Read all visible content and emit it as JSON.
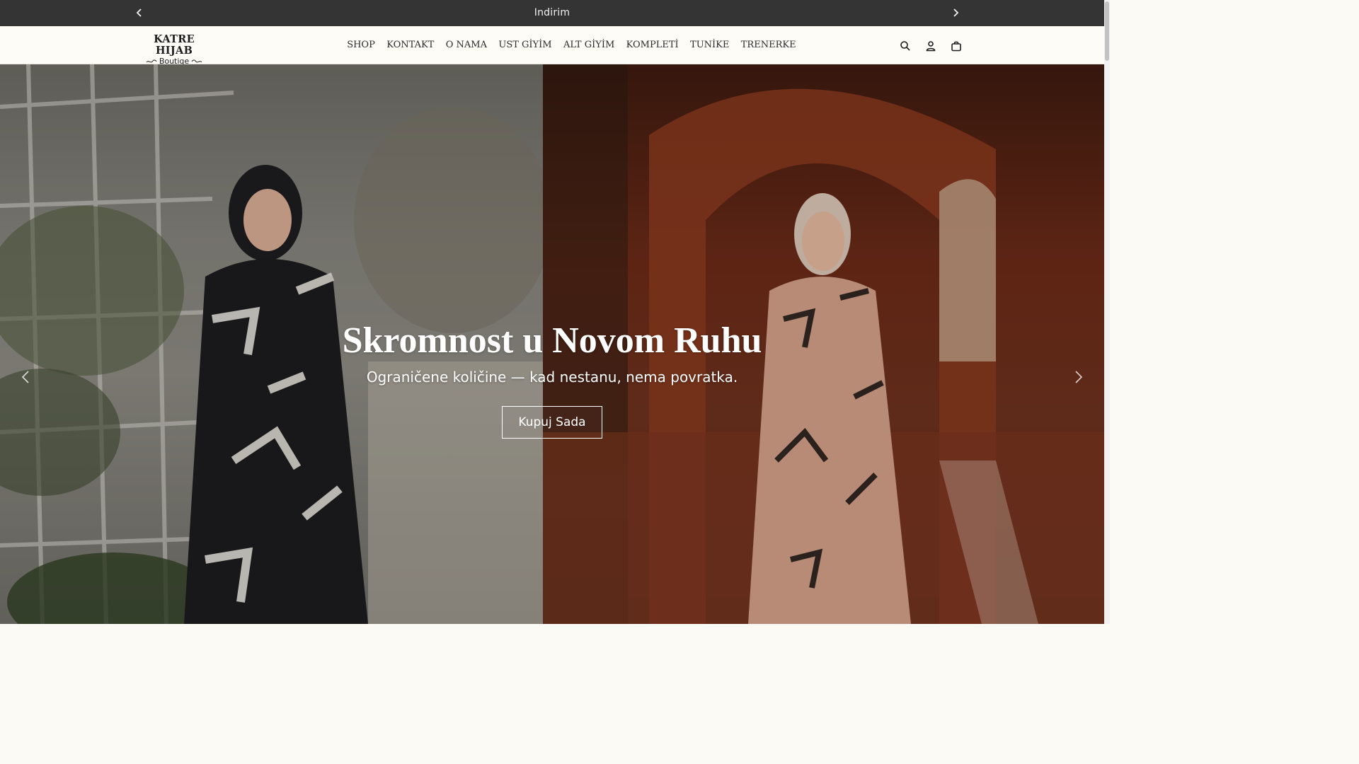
{
  "announcement": {
    "text": "Indirim",
    "prev_icon": "chevron-left-icon",
    "next_icon": "chevron-right-icon"
  },
  "header": {
    "logo": {
      "brand": "KATRE HIJAB",
      "subtitle": "Boutiqe"
    },
    "nav": [
      {
        "label": "SHOP"
      },
      {
        "label": "KONTAKT"
      },
      {
        "label": "O NAMA"
      },
      {
        "label": "UST GİYİM"
      },
      {
        "label": "ALT GİYİM"
      },
      {
        "label": "KOMPLETİ"
      },
      {
        "label": "TUNİKE"
      },
      {
        "label": "TRENERKE"
      }
    ],
    "icons": [
      "search-icon",
      "account-icon",
      "cart-icon"
    ]
  },
  "hero": {
    "title": "Skromnost u Novom Ruhu",
    "subtitle": "Ograničene količine — kad nestanu, nema povratka.",
    "button_label": "Kupuj Sada",
    "prev_icon": "chevron-left-icon",
    "next_icon": "chevron-right-icon"
  },
  "colors": {
    "announcement_bg": "#343434",
    "header_bg": "#fdfcf7",
    "text_dark": "#2b2b2b",
    "hero_text": "#ffffff"
  }
}
